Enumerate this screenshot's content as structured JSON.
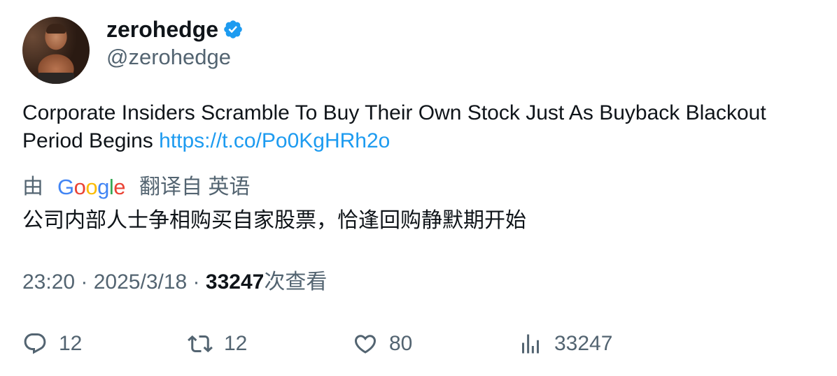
{
  "author": {
    "display_name": "zerohedge",
    "handle": "@zerohedge",
    "verified_icon": "verified-badge-icon",
    "verified_color": "#1d9bf0"
  },
  "tweet": {
    "text": "Corporate Insiders Scramble To Buy Their Own Stock Just As Buyback Blackout Period Begins",
    "link": "https://t.co/Po0KgHRh2o",
    "link_color": "#1d9bf0"
  },
  "translation": {
    "by_label": "由",
    "provider": "Google",
    "from_label": "翻译自 英语",
    "text": "公司内部人士争相购买自家股票，恰逢回购静默期开始"
  },
  "meta": {
    "time": "23:20",
    "separator": " · ",
    "date": "2025/3/18",
    "views_count": "33247",
    "views_label": "次查看"
  },
  "actions": {
    "reply_count": "12",
    "retweet_count": "12",
    "like_count": "80",
    "views_count": "33247",
    "reply_icon": "reply-icon",
    "retweet_icon": "retweet-icon",
    "like_icon": "heart-icon",
    "views_icon": "bar-chart-icon"
  },
  "colors": {
    "text": "#0f1419",
    "secondary": "#536471",
    "accent": "#1d9bf0"
  }
}
